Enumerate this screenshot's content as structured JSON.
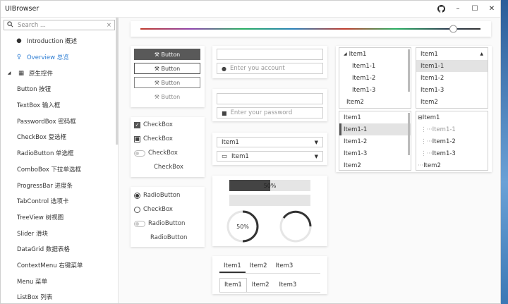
{
  "window": {
    "title": "UIBrowser"
  },
  "sidebar": {
    "search_placeholder": "Search ...",
    "items": [
      {
        "label": "Introduction 概述"
      },
      {
        "label": "Overview 总览"
      },
      {
        "label": "原生控件"
      },
      {
        "label": "Button 按钮"
      },
      {
        "label": "TextBox 输入框"
      },
      {
        "label": "PasswordBox 密码框"
      },
      {
        "label": "CheckBox 复选框"
      },
      {
        "label": "RadioButton 单选框"
      },
      {
        "label": "ComboBox 下拉单选框"
      },
      {
        "label": "ProgressBar 进度条"
      },
      {
        "label": "TabControl 选项卡"
      },
      {
        "label": "TreeView 树视图"
      },
      {
        "label": "Slider 滑块"
      },
      {
        "label": "DataGrid 数据表格"
      },
      {
        "label": "ContextMenu 右键菜单"
      },
      {
        "label": "Menu 菜单"
      },
      {
        "label": "ListBox 列表"
      }
    ]
  },
  "slider": {
    "value": 0.92
  },
  "buttons": {
    "b1": "Button",
    "b2": "Button",
    "b3": "Button",
    "b4": "Button"
  },
  "textbox": {
    "placeholder": "Enter you account"
  },
  "password": {
    "placeholder": "Enter your password"
  },
  "checkboxes": {
    "c1": "CheckBox",
    "c2": "CheckBox",
    "c3": "CheckBox",
    "c4": "CheckBox"
  },
  "radios": {
    "r1": "RadioButton",
    "r2": "CheckBox",
    "r3": "RadioButton",
    "r4": "RadioButton"
  },
  "combos": {
    "c1": "Item1",
    "c2": "Item1"
  },
  "progress": {
    "bar_text": "50%",
    "bar_value": 0.5,
    "ring_text": "50%"
  },
  "tabs1": [
    "Item1",
    "Item2",
    "Item3"
  ],
  "tabs2": [
    "Item1",
    "Item2",
    "Item3"
  ],
  "list1": [
    "Item1",
    "Item1-1",
    "Item1-2",
    "Item1-3",
    "Item2"
  ],
  "list2": [
    "Item1",
    "Item1-1",
    "Item1-2",
    "Item1-3",
    "Item2"
  ],
  "list3": [
    "Item1",
    "Item1-1",
    "Item1-2",
    "Item1-3",
    "Item2"
  ],
  "list4": [
    "Item1",
    "Item1-1",
    "Item1-2",
    "Item1-3",
    "Item2"
  ],
  "colors": {
    "accent": "#2b7cd3",
    "dark": "#595959"
  }
}
